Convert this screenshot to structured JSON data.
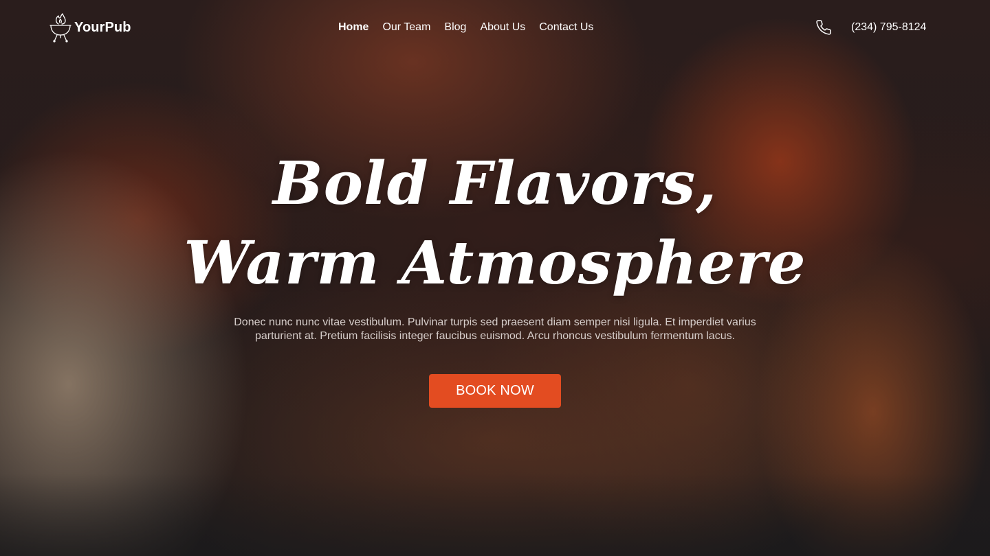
{
  "brand": {
    "name": "YourPub",
    "logo_icon": "grill-flame-icon"
  },
  "nav": {
    "items": [
      {
        "label": "Home",
        "active": true
      },
      {
        "label": "Our Team",
        "active": false
      },
      {
        "label": "Blog",
        "active": false
      },
      {
        "label": "About Us",
        "active": false
      },
      {
        "label": "Contact Us",
        "active": false
      }
    ]
  },
  "contact": {
    "phone_icon": "phone-icon",
    "phone": "(234) 795-8124"
  },
  "hero": {
    "title_line1": "Bold Flavors,",
    "title_line2": "Warm Atmosphere",
    "description": "Donec nunc nunc vitae vestibulum. Pulvinar turpis sed praesent diam semper nisi ligula. Et imperdiet varius parturient at. Pretium facilisis integer faucibus euismod. Arcu rhoncus vestibulum fermentum lacus.",
    "cta_label": "BOOK NOW"
  },
  "colors": {
    "accent": "#e34c21",
    "text": "#ffffff",
    "muted_text": "#d6cdca",
    "background": "#1b1a1b"
  }
}
